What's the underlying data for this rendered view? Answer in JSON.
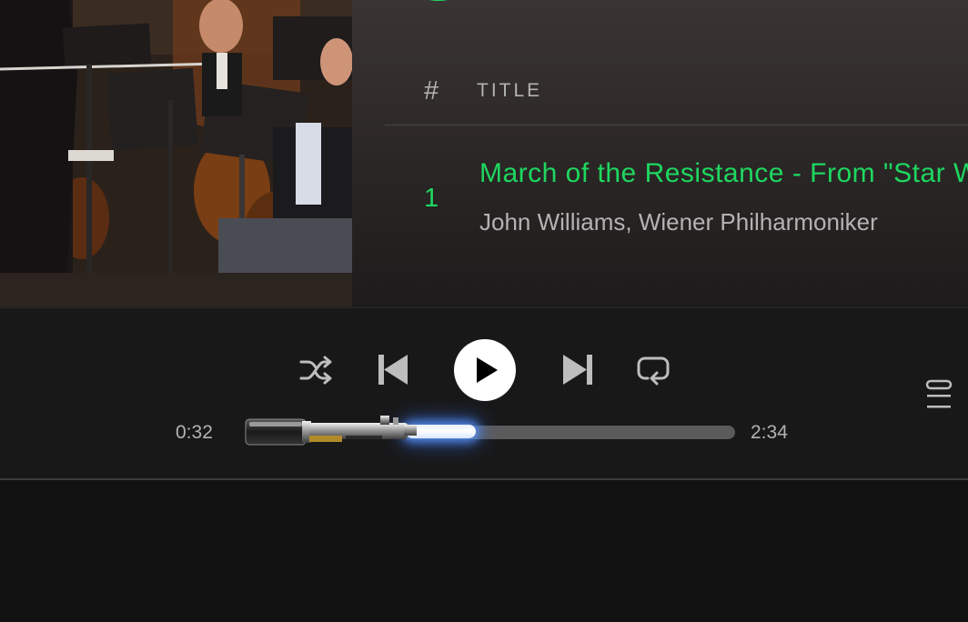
{
  "tracklist": {
    "header": {
      "number_label": "#",
      "title_label": "TITLE"
    },
    "tracks": [
      {
        "number": "1",
        "title": "March of the Resistance - From \"Star Wars: The Force Awakens\"",
        "artists": "John Williams, Wiener Philharmoniker"
      }
    ]
  },
  "player": {
    "elapsed": "0:32",
    "duration": "2:34",
    "progress_fraction": 0.21,
    "controls": [
      "shuffle-icon",
      "previous-icon",
      "play-icon",
      "next-icon",
      "repeat-icon",
      "queue-icon"
    ],
    "progress_style": "lightsaber"
  },
  "colors": {
    "accent": "#1ed760",
    "player_background": "#181818",
    "secondary_text": "#b3b3b3",
    "saber_glow": "#5a96ff"
  }
}
